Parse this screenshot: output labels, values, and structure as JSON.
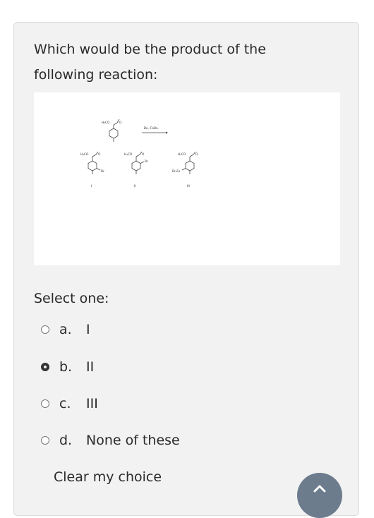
{
  "question": {
    "text": "Which would be the product of the following reaction:"
  },
  "figure": {
    "reactant_group": "H₃CO",
    "reagents": "Br₂, FeBr₃",
    "product_group": "H₃CO",
    "substituent": "Br",
    "product_III_substituent": "Br₂Fe",
    "labels": [
      "I",
      "II",
      "III"
    ]
  },
  "select_one_label": "Select one:",
  "options": [
    {
      "letter": "a.",
      "label": "I",
      "checked": false
    },
    {
      "letter": "b.",
      "label": "II",
      "checked": true
    },
    {
      "letter": "c.",
      "label": "III",
      "checked": false
    },
    {
      "letter": "d.",
      "label": "None of these",
      "checked": false
    }
  ],
  "clear_choice": "Clear my choice",
  "colors": {
    "card_background": "#f2f2f2",
    "fab_background": "#6c7c8d"
  },
  "icons": {
    "radio": "radio-button-icon",
    "fab": "chevron-up-icon"
  }
}
